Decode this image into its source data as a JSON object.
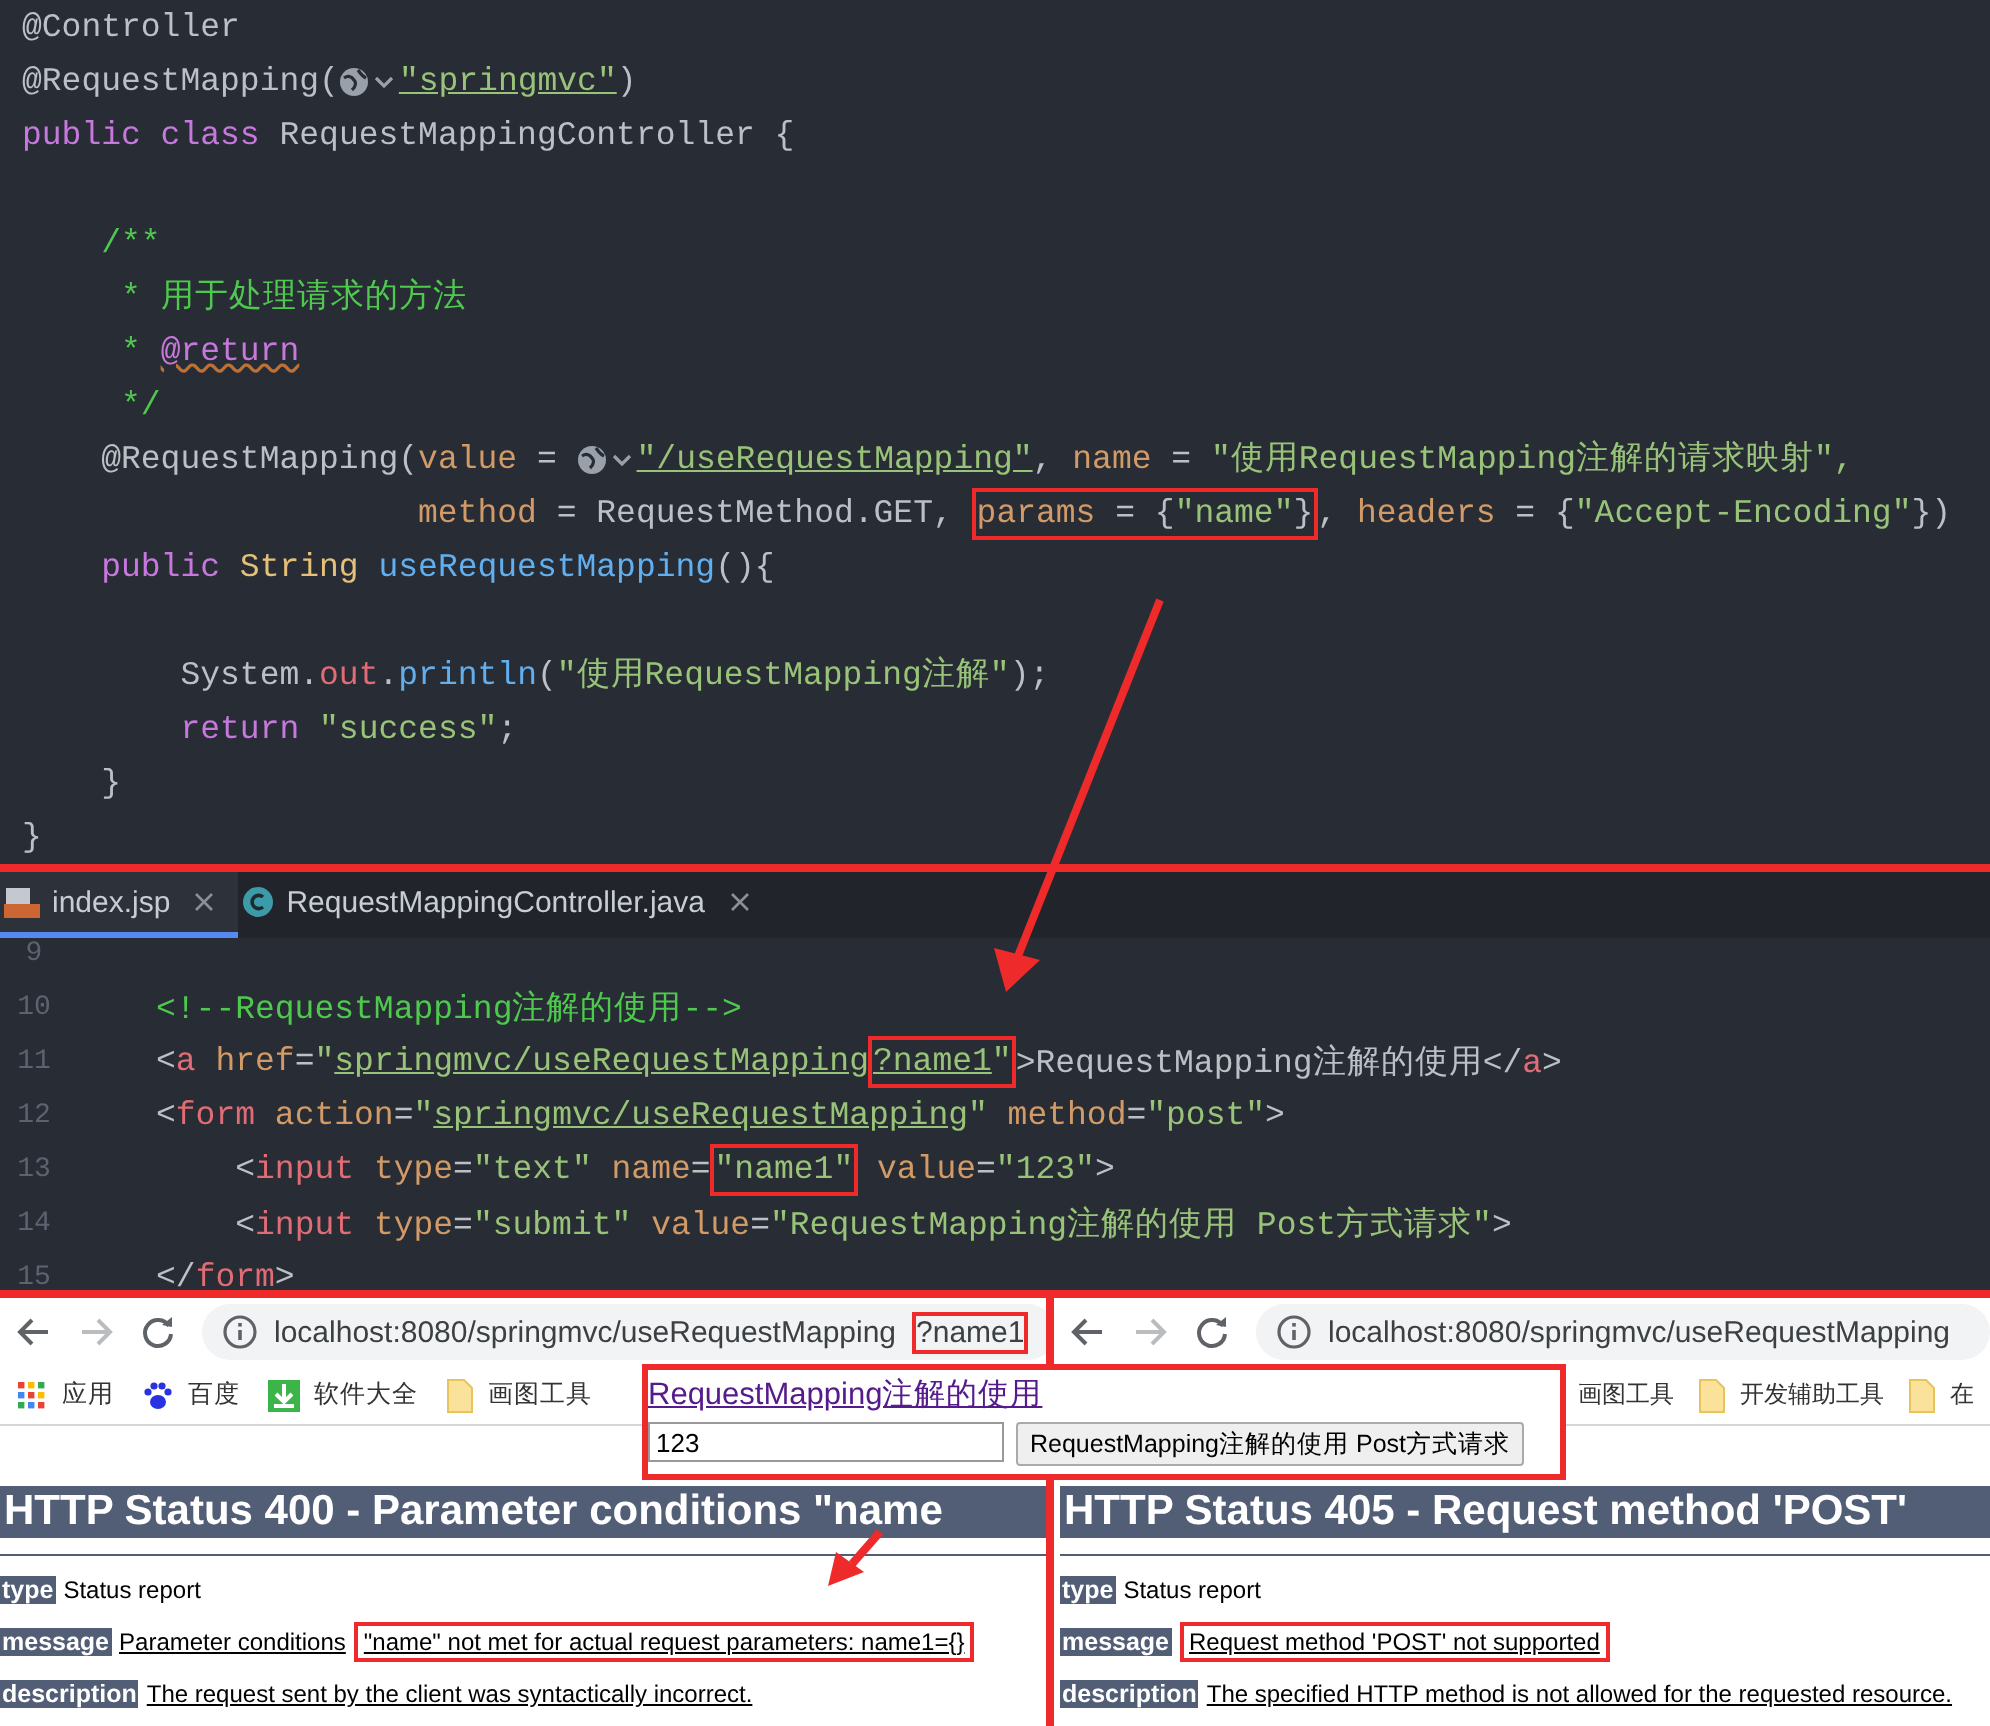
{
  "editor_top": {
    "lines": [
      {
        "kind": "code",
        "segments": [
          {
            "kind": "annotation",
            "text": "@Controller"
          }
        ]
      },
      {
        "kind": "code",
        "segments": [
          {
            "kind": "annotation",
            "text": "@RequestMapping("
          },
          {
            "kind": "globe"
          },
          {
            "kind": "link",
            "text": "\"springmvc\""
          },
          {
            "kind": "annotation",
            "text": ")"
          }
        ]
      },
      {
        "kind": "code",
        "segments": [
          {
            "kind": "keyword",
            "text": "public class "
          },
          {
            "kind": "plain",
            "text": "RequestMappingController {"
          }
        ]
      },
      {
        "kind": "blank"
      },
      {
        "kind": "code",
        "segments": [
          {
            "kind": "comment",
            "text": "    /**"
          }
        ]
      },
      {
        "kind": "code",
        "segments": [
          {
            "kind": "comment",
            "text": "     * 用于处理请求的方法"
          }
        ]
      },
      {
        "kind": "code",
        "segments": [
          {
            "kind": "comment",
            "text": "     * "
          },
          {
            "kind": "doctag",
            "text": "@return"
          }
        ]
      },
      {
        "kind": "code",
        "segments": [
          {
            "kind": "comment",
            "text": "     */"
          }
        ]
      },
      {
        "kind": "code",
        "segments": [
          {
            "kind": "annotation",
            "text": "    @RequestMapping("
          },
          {
            "kind": "attr",
            "text": "value"
          },
          {
            "kind": "plain",
            "text": " = "
          },
          {
            "kind": "globe"
          },
          {
            "kind": "link",
            "text": "\"/useRequestMapping\""
          },
          {
            "kind": "plain",
            "text": ", "
          },
          {
            "kind": "attr",
            "text": "name"
          },
          {
            "kind": "plain",
            "text": " = "
          },
          {
            "kind": "string",
            "text": "\"使用RequestMapping注解的请求映射\","
          }
        ]
      },
      {
        "kind": "code",
        "segments": [
          {
            "kind": "attr",
            "text": "                    method"
          },
          {
            "kind": "plain",
            "text": " = RequestMethod.GET, "
          },
          {
            "kind": "callout",
            "segments": [
              {
                "kind": "attr",
                "text": "params"
              },
              {
                "kind": "plain",
                "text": " = {"
              },
              {
                "kind": "string",
                "text": "\"name\""
              },
              {
                "kind": "plain",
                "text": "}"
              }
            ]
          },
          {
            "kind": "plain",
            "text": ", "
          },
          {
            "kind": "attr",
            "text": "headers"
          },
          {
            "kind": "plain",
            "text": " = {"
          },
          {
            "kind": "string",
            "text": "\"Accept-Encoding\""
          },
          {
            "kind": "plain",
            "text": "})"
          }
        ]
      },
      {
        "kind": "code",
        "segments": [
          {
            "kind": "keyword",
            "text": "    public "
          },
          {
            "kind": "type",
            "text": "String "
          },
          {
            "kind": "method",
            "text": "useRequestMapping"
          },
          {
            "kind": "plain",
            "text": "(){"
          }
        ]
      },
      {
        "kind": "blank"
      },
      {
        "kind": "code",
        "segments": [
          {
            "kind": "plain",
            "text": "        System."
          },
          {
            "kind": "field",
            "text": "out"
          },
          {
            "kind": "plain",
            "text": "."
          },
          {
            "kind": "method",
            "text": "println"
          },
          {
            "kind": "plain",
            "text": "("
          },
          {
            "kind": "string",
            "text": "\"使用RequestMapping注解\""
          },
          {
            "kind": "plain",
            "text": ");"
          }
        ]
      },
      {
        "kind": "code",
        "segments": [
          {
            "kind": "keyword",
            "text": "        return "
          },
          {
            "kind": "string",
            "text": "\"success\""
          },
          {
            "kind": "plain",
            "text": ";"
          }
        ]
      },
      {
        "kind": "code",
        "segments": [
          {
            "kind": "plain",
            "text": "    }"
          }
        ]
      },
      {
        "kind": "code",
        "segments": [
          {
            "kind": "plain",
            "text": "}"
          }
        ]
      }
    ]
  },
  "editor_bottom": {
    "tabs": [
      {
        "label": "index.jsp",
        "kind": "jsp",
        "selected": true
      },
      {
        "label": "RequestMappingController.java",
        "kind": "class",
        "selected": false
      }
    ],
    "lines": [
      {
        "number": "9"
      },
      {
        "number": "10",
        "segments": [
          {
            "kind": "comment",
            "text": "<!--RequestMapping注解的使用-->"
          }
        ]
      },
      {
        "number": "11",
        "segments": [
          {
            "kind": "plain",
            "text": "<"
          },
          {
            "kind": "tag",
            "text": "a "
          },
          {
            "kind": "attr",
            "text": "href"
          },
          {
            "kind": "plain",
            "text": "="
          },
          {
            "kind": "string",
            "text": "\""
          },
          {
            "kind": "link",
            "text": "springmvc/useRequestMapping"
          },
          {
            "kind": "callout",
            "segments": [
              {
                "kind": "link",
                "text": "?name1"
              },
              {
                "kind": "string",
                "text": "\""
              }
            ]
          },
          {
            "kind": "plain",
            "text": ">RequestMapping注解的使用</"
          },
          {
            "kind": "tag",
            "text": "a"
          },
          {
            "kind": "plain",
            "text": ">"
          }
        ]
      },
      {
        "number": "12",
        "segments": [
          {
            "kind": "plain",
            "text": "<"
          },
          {
            "kind": "tag",
            "text": "form "
          },
          {
            "kind": "attr",
            "text": "action"
          },
          {
            "kind": "plain",
            "text": "="
          },
          {
            "kind": "string",
            "text": "\""
          },
          {
            "kind": "link",
            "text": "springmvc/useRequestMapping"
          },
          {
            "kind": "string",
            "text": "\""
          },
          {
            "kind": "attr",
            "text": " method"
          },
          {
            "kind": "plain",
            "text": "="
          },
          {
            "kind": "string",
            "text": "\"post\""
          },
          {
            "kind": "plain",
            "text": ">"
          }
        ]
      },
      {
        "number": "13",
        "segments": [
          {
            "kind": "plain",
            "text": "    <"
          },
          {
            "kind": "tag",
            "text": "input "
          },
          {
            "kind": "attr",
            "text": "type"
          },
          {
            "kind": "plain",
            "text": "="
          },
          {
            "kind": "string",
            "text": "\"text\" "
          },
          {
            "kind": "attr",
            "text": "name"
          },
          {
            "kind": "plain",
            "text": "="
          },
          {
            "kind": "callout",
            "segments": [
              {
                "kind": "string",
                "text": "\"name1\""
              }
            ]
          },
          {
            "kind": "attr",
            "text": " value"
          },
          {
            "kind": "plain",
            "text": "="
          },
          {
            "kind": "string",
            "text": "\"123\""
          },
          {
            "kind": "plain",
            "text": ">"
          }
        ]
      },
      {
        "number": "14",
        "segments": [
          {
            "kind": "plain",
            "text": "    <"
          },
          {
            "kind": "tag",
            "text": "input "
          },
          {
            "kind": "attr",
            "text": "type"
          },
          {
            "kind": "plain",
            "text": "="
          },
          {
            "kind": "string",
            "text": "\"submit\" "
          },
          {
            "kind": "attr",
            "text": "value"
          },
          {
            "kind": "plain",
            "text": "="
          },
          {
            "kind": "string",
            "text": "\"RequestMapping注解的使用 Post方式请求\""
          },
          {
            "kind": "plain",
            "text": ">"
          }
        ]
      },
      {
        "number": "15",
        "segments": [
          {
            "kind": "plain",
            "text": "</"
          },
          {
            "kind": "tag",
            "text": "form"
          },
          {
            "kind": "plain",
            "text": ">"
          }
        ]
      }
    ]
  },
  "browsers": [
    {
      "forward_disabled": true,
      "url": [
        {
          "kind": "plain",
          "text": "localhost:8080/springmvc/useRequestMapping"
        },
        {
          "kind": "callout",
          "text": "?name1"
        }
      ],
      "bookmarks": [
        {
          "label": "应用",
          "kind": "apps"
        },
        {
          "label": "百度",
          "kind": "paw"
        },
        {
          "label": "软件大全",
          "kind": "download"
        },
        {
          "label": "画图工具",
          "kind": "folder"
        }
      ],
      "heading": "HTTP Status 400 - Parameter conditions \"name",
      "details": [
        {
          "label": "type",
          "segments": [
            {
              "kind": "plain",
              "text": "Status report"
            }
          ]
        },
        {
          "label": "message",
          "segments": [
            {
              "kind": "underline",
              "text": "Parameter conditions "
            },
            {
              "kind": "callout",
              "text": "\"name\" not met for actual request parameters: name1={}"
            }
          ]
        },
        {
          "label": "description",
          "segments": [
            {
              "kind": "underline",
              "text": "The request sent by the client was syntactically incorrect."
            }
          ]
        }
      ]
    },
    {
      "forward_disabled": true,
      "url": [
        {
          "kind": "plain",
          "text": "localhost:8080/springmvc/useRequestMapping"
        }
      ],
      "bookmarks": [
        {
          "label": "画图工具",
          "kind": "none"
        },
        {
          "label": "开发辅助工具",
          "kind": "folder"
        },
        {
          "label": "在",
          "kind": "folder"
        }
      ],
      "heading": "HTTP Status 405 - Request method 'POST'",
      "details": [
        {
          "label": "type",
          "segments": [
            {
              "kind": "plain",
              "text": "Status report"
            }
          ]
        },
        {
          "label": "message",
          "segments": [
            {
              "kind": "callout",
              "text": "Request method 'POST' not supported"
            }
          ]
        },
        {
          "label": "description",
          "segments": [
            {
              "kind": "underline",
              "text": "The specified HTTP method is not allowed for the requested resource."
            }
          ]
        }
      ]
    }
  ],
  "rendered_form": {
    "link": "RequestMapping注解的使用",
    "input_value": "123",
    "submit": "RequestMapping注解的使用 Post方式请求"
  }
}
